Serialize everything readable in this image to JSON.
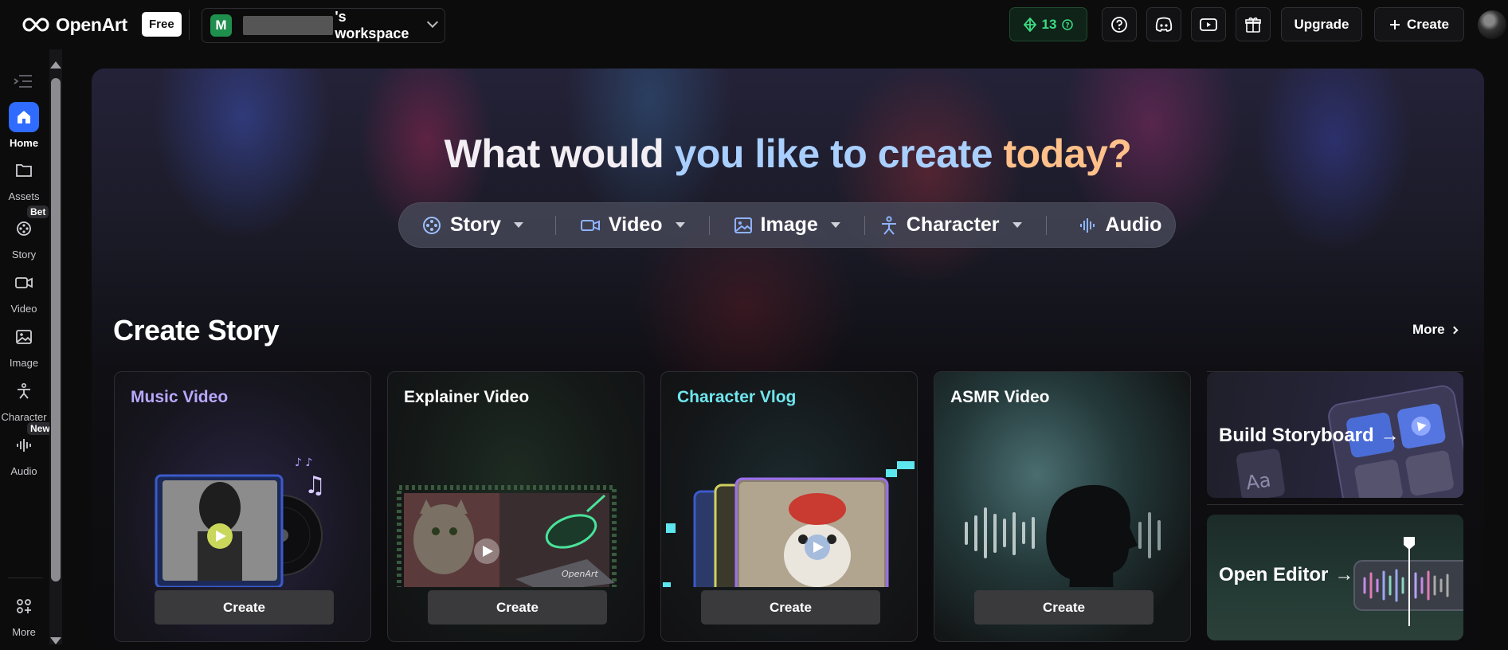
{
  "topbar": {
    "logo_text": "OpenArt",
    "plan_badge": "Free",
    "workspace_initial": "M",
    "workspace_name": "'s workspace",
    "credits": "13",
    "upgrade_label": "Upgrade",
    "create_label": "Create"
  },
  "sidebar": {
    "items": [
      {
        "label": "Home"
      },
      {
        "label": "Assets"
      },
      {
        "label": "Story",
        "badge": "Bet"
      },
      {
        "label": "Video"
      },
      {
        "label": "Image"
      },
      {
        "label": "Character"
      },
      {
        "label": "Audio",
        "badge": "New"
      },
      {
        "label": "More"
      }
    ]
  },
  "hero": {
    "headline_part1": "What would ",
    "headline_part2": "you like to ",
    "headline_part3": "create ",
    "headline_part4": "today?",
    "types": [
      {
        "label": "Story"
      },
      {
        "label": "Video"
      },
      {
        "label": "Image"
      },
      {
        "label": "Character"
      },
      {
        "label": "Audio"
      }
    ]
  },
  "section": {
    "title": "Create Story",
    "more_label": "More",
    "cards": [
      {
        "title": "Music Video",
        "title_color": "#b9a8ff",
        "button": "Create"
      },
      {
        "title": "Explainer Video",
        "title_color": "#ffffff",
        "button": "Create"
      },
      {
        "title": "Character Vlog",
        "title_color": "#6fe6ee",
        "button": "Create"
      },
      {
        "title": "ASMR Video",
        "title_color": "#ffffff",
        "button": "Create"
      }
    ],
    "side_cards": [
      {
        "title": "Build Storyboard",
        "arrow": "→"
      },
      {
        "title": "Open Editor",
        "arrow": "→"
      }
    ]
  },
  "colors": {
    "accent_blue": "#2f6bff",
    "credits_green": "#3ddc84"
  }
}
